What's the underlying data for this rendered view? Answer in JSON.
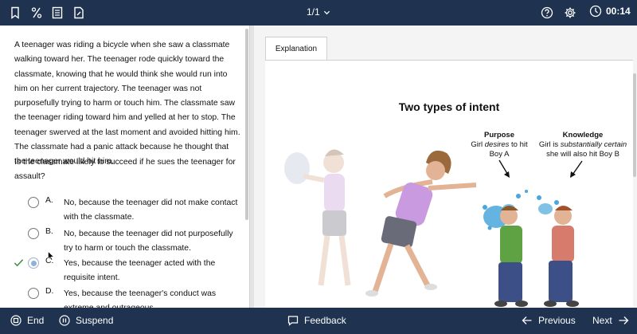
{
  "header": {
    "page_indicator": "1/1",
    "timer": "00:14",
    "icons": [
      "bookmark-icon",
      "percent-icon",
      "notebook-icon",
      "edit-document-icon",
      "help-icon",
      "gear-icon",
      "clock-icon",
      "chevron-down-icon"
    ]
  },
  "question": {
    "stem": "A teenager was riding a bicycle when she saw a classmate walking toward her.  The teenager rode quickly toward the classmate, knowing that he would think she would run into him on her current trajectory.  The teenager was not purposefully trying to harm or touch him.  The classmate saw the teenager riding toward him and yelled at her to stop.  The teenager swerved at the last moment and avoided hitting him.  The classmate had a panic attack because he thought that the teenager would hit him.",
    "prompt": "Is the classmate likely to succeed if he sues the teenager for assault?",
    "choices": [
      {
        "letter": "A.",
        "text": "No, because the teenager did not make contact with the classmate.",
        "selected": false,
        "correct": false
      },
      {
        "letter": "B.",
        "text": "No, because the teenager did not purposefully try to harm or touch the classmate.",
        "selected": false,
        "correct": false
      },
      {
        "letter": "C.",
        "text": "Yes, because the teenager acted with the requisite intent.",
        "selected": true,
        "correct": true
      },
      {
        "letter": "D.",
        "text": "Yes, because the teenager's conduct was extreme and outrageous.",
        "selected": false,
        "correct": false
      }
    ]
  },
  "explanation": {
    "tab_label": "Explanation",
    "illustration": {
      "title": "Two types of intent",
      "purpose_heading": "Purpose",
      "purpose_line1_a": "Girl ",
      "purpose_line1_em": "desires",
      "purpose_line1_b": " to hit",
      "purpose_line2": "Boy A",
      "knowledge_heading": "Knowledge",
      "knowledge_line1_a": "Girl is ",
      "knowledge_line1_em": "substantially certain",
      "knowledge_line2": "she will also hit Boy B"
    }
  },
  "footer": {
    "end_label": "End",
    "suspend_label": "Suspend",
    "feedback_label": "Feedback",
    "previous_label": "Previous",
    "next_label": "Next"
  },
  "colors": {
    "bar_bg": "#1f3350",
    "correct_check": "#3a8a3a",
    "selected_radio": "#8fb0d8"
  }
}
